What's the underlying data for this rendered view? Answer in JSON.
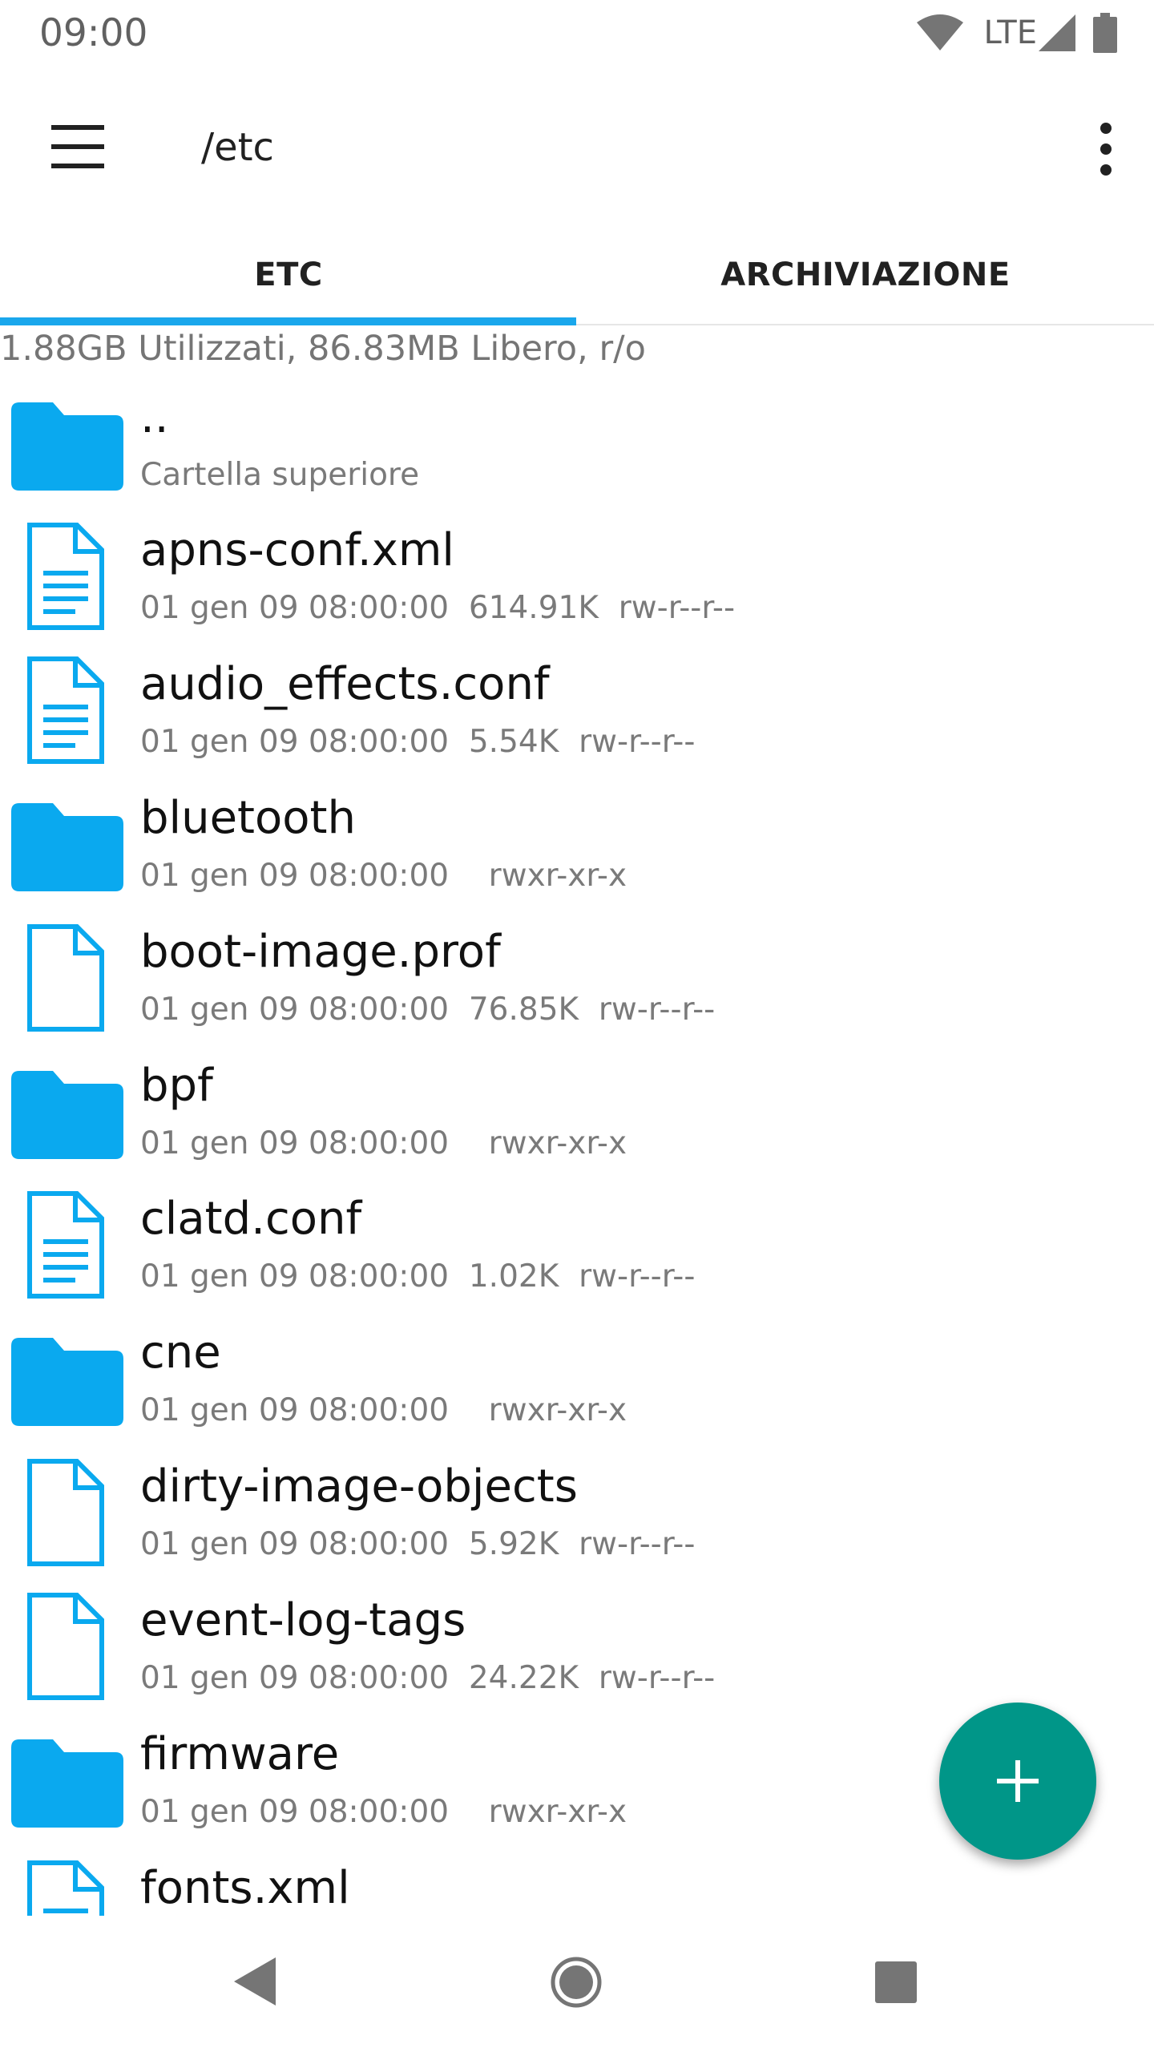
{
  "status_bar": {
    "time": "09:00",
    "network": "LTE",
    "icons": [
      "wifi-icon",
      "signal-icon",
      "battery-icon"
    ]
  },
  "toolbar": {
    "title": "/etc",
    "menu_icon": "hamburger-menu-icon",
    "overflow_icon": "more-vert-icon"
  },
  "tabs": [
    {
      "label": "ETC",
      "selected": true
    },
    {
      "label": "ARCHIVIAZIONE",
      "selected": false
    }
  ],
  "storage_info": "1.88GB Utilizzati, 86.83MB Libero, r/o",
  "files": [
    {
      "type": "folder",
      "name": "..",
      "meta": "Cartella superiore"
    },
    {
      "type": "doc",
      "name": "apns-conf.xml",
      "meta": "01 gen 09 08:00:00  614.91K  rw-r--r--"
    },
    {
      "type": "doc",
      "name": "audio_effects.conf",
      "meta": "01 gen 09 08:00:00  5.54K  rw-r--r--"
    },
    {
      "type": "folder",
      "name": "bluetooth",
      "meta": "01 gen 09 08:00:00    rwxr-xr-x"
    },
    {
      "type": "file",
      "name": "boot-image.prof",
      "meta": "01 gen 09 08:00:00  76.85K  rw-r--r--"
    },
    {
      "type": "folder",
      "name": "bpf",
      "meta": "01 gen 09 08:00:00    rwxr-xr-x"
    },
    {
      "type": "doc",
      "name": "clatd.conf",
      "meta": "01 gen 09 08:00:00  1.02K  rw-r--r--"
    },
    {
      "type": "folder",
      "name": "cne",
      "meta": "01 gen 09 08:00:00    rwxr-xr-x"
    },
    {
      "type": "file",
      "name": "dirty-image-objects",
      "meta": "01 gen 09 08:00:00  5.92K  rw-r--r--"
    },
    {
      "type": "file",
      "name": "event-log-tags",
      "meta": "01 gen 09 08:00:00  24.22K  rw-r--r--"
    },
    {
      "type": "folder",
      "name": "firmware",
      "meta": "01 gen 09 08:00:00    rwxr-xr-x"
    },
    {
      "type": "doc",
      "name": "fonts.xml",
      "meta": ""
    }
  ],
  "fab": {
    "icon": "add-icon",
    "color": "#009688"
  },
  "colors": {
    "accent": "#1aa7ec",
    "folder": "#0aa9ef"
  },
  "nav_bar": [
    "back-icon",
    "home-icon",
    "recents-icon"
  ]
}
